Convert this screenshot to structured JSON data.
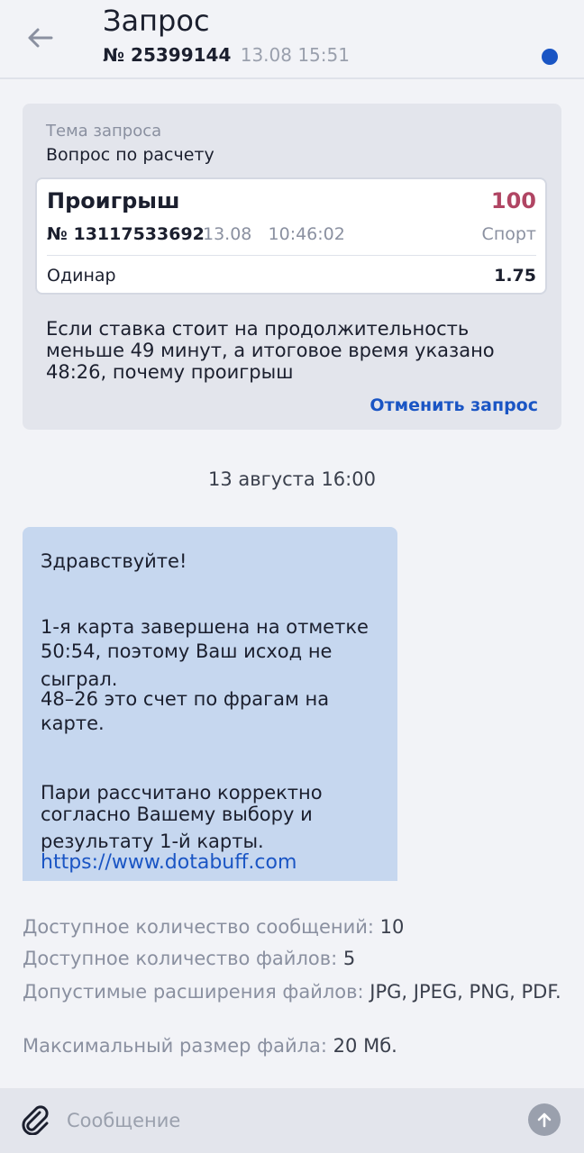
{
  "header": {
    "title": "Запрос",
    "request_number": "№ 25399144",
    "request_time": "13.08 15:51"
  },
  "request": {
    "topic_label": "Тема запроса",
    "topic_value": "Вопрос по расчету",
    "bet": {
      "status": "Проигрыш",
      "amount": "100",
      "number": "№ 13117533692",
      "datetime": "13.08   10:46:02",
      "category": "Спорт",
      "type": "Одинар",
      "odds": "1.75"
    },
    "question": "Если ставка стоит на продолжительность меньше 49 минут, а итоговое время указано 48:26, почему проигрыш",
    "cancel_label": "Отменить запрос"
  },
  "date_separator": "13 августа 16:00",
  "message": {
    "greeting": "Здравствуйте!",
    "line1": "1-я карта завершена на отметке 50:54, поэтому Ваш исход не",
    "line2": "сыграл.",
    "line3": "48–26 это счет по фрагам на карте.",
    "line4": "Пари рассчитано корректно",
    "line5": "согласно Вашему выбору и",
    "line6": "результату 1-й карты.",
    "link": "https://www.dotabuff.com"
  },
  "limits": {
    "messages_label": "Доступное количество сообщений:",
    "messages_value": "10",
    "files_label": "Доступное количество файлов:",
    "files_value": "5",
    "ext_label": "Допустимые расширения файлов:",
    "ext_value": "JPG, JPEG, PNG, PDF.",
    "size_label": "Максимальный размер файла:",
    "size_value": "20 Мб."
  },
  "composer": {
    "placeholder": "Сообщение"
  },
  "colors": {
    "accent": "#1a55c4",
    "loss": "#b04563",
    "bubble": "#c6d7ef"
  }
}
